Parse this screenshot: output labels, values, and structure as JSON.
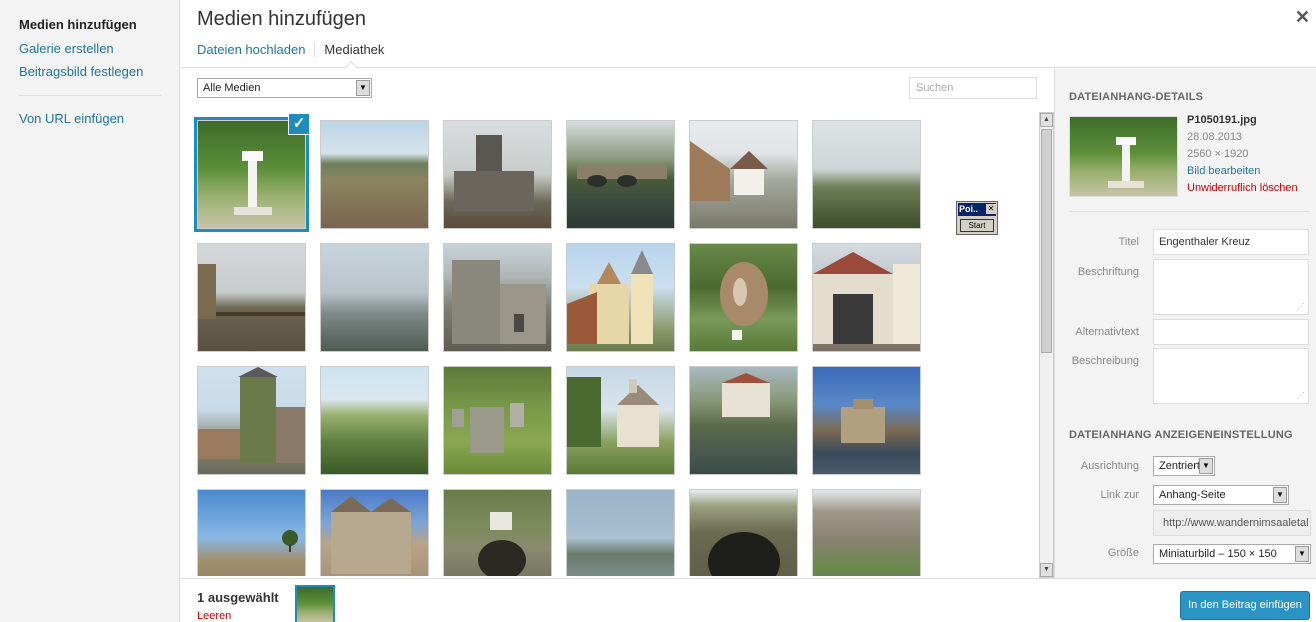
{
  "sidebar": {
    "items": [
      "Medien hinzufügen",
      "Galerie erstellen",
      "Beitragsbild festlegen",
      "Von URL einfügen"
    ]
  },
  "header": {
    "title": "Medien hinzufügen",
    "close_icon": "close-icon",
    "tabs": [
      "Dateien hochladen",
      "Mediathek"
    ]
  },
  "filter": {
    "selected": "Alle Medien",
    "search_placeholder": "Suchen"
  },
  "popup": {
    "title": "Poi..",
    "button": "Start"
  },
  "details": {
    "heading": "DATEIANHANG-DETAILS",
    "filename": "P1050191.jpg",
    "date": "28.08.2013",
    "dimensions": "2560 × 1920",
    "edit_link": "Bild bearbeiten",
    "delete_link": "Unwiderruflich löschen",
    "title_label": "Titel",
    "title_value": "Engenthaler Kreuz",
    "caption_label": "Beschriftung",
    "alt_label": "Alternativtext",
    "description_label": "Beschreibung",
    "display_heading": "DATEIANHANG ANZEIGENEINSTELLUNG",
    "align_label": "Ausrichtung",
    "align_value": "Zentriert",
    "link_label": "Link zur",
    "link_value": "Anhang-Seite",
    "url_value": "http://www.wandernimsaaletal",
    "size_label": "Größe",
    "size_value": "Miniaturbild – 150 × 150"
  },
  "footer": {
    "selected_count": "1 ausgewählt",
    "clear_link": "Leeren",
    "insert_button": "In den Beitrag einfügen"
  },
  "colors": {
    "accent": "#1e8cbe",
    "link": "#21759b",
    "danger": "#cc0000",
    "button": "#2a95c5"
  }
}
